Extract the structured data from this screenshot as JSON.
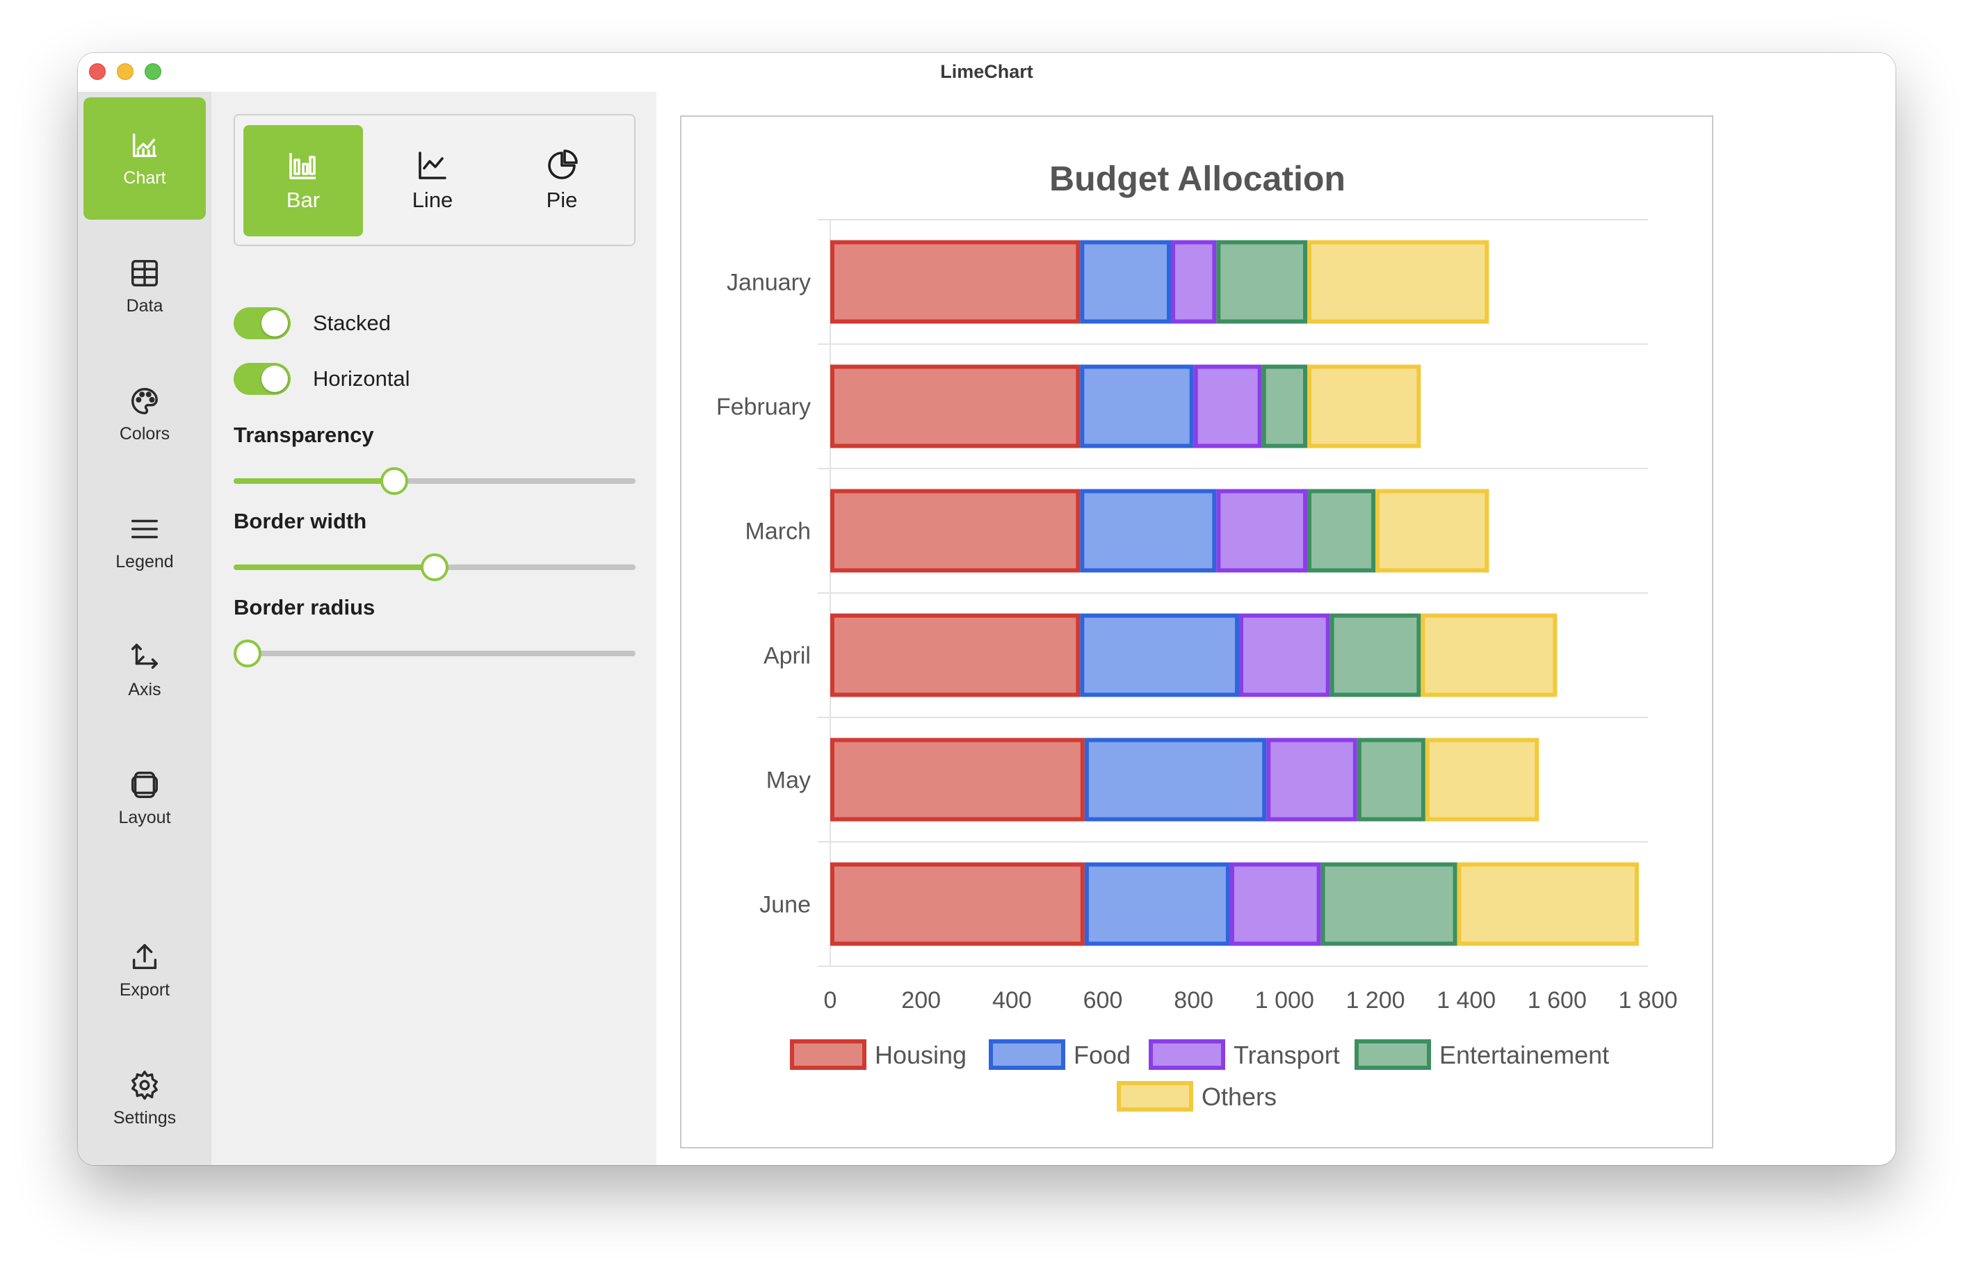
{
  "window": {
    "title": "LimeChart"
  },
  "sidebar": {
    "items": [
      {
        "label": "Chart",
        "icon": "chart-icon",
        "active": true
      },
      {
        "label": "Data",
        "icon": "table-icon",
        "active": false
      },
      {
        "label": "Colors",
        "icon": "palette-icon",
        "active": false
      },
      {
        "label": "Legend",
        "icon": "list-icon",
        "active": false
      },
      {
        "label": "Axis",
        "icon": "axis-icon",
        "active": false
      },
      {
        "label": "Layout",
        "icon": "layers-icon",
        "active": false
      },
      {
        "label": "Export",
        "icon": "upload-icon",
        "active": false
      },
      {
        "label": "Settings",
        "icon": "gear-icon",
        "active": false
      }
    ]
  },
  "panel": {
    "chart_types": [
      {
        "label": "Bar",
        "icon": "bar-chart-icon",
        "active": true
      },
      {
        "label": "Line",
        "icon": "line-chart-icon",
        "active": false
      },
      {
        "label": "Pie",
        "icon": "pie-chart-icon",
        "active": false
      }
    ],
    "toggles": [
      {
        "label": "Stacked",
        "on": true
      },
      {
        "label": "Horizontal",
        "on": true
      }
    ],
    "sliders": [
      {
        "label": "Transparency",
        "value": 0.4
      },
      {
        "label": "Border width",
        "value": 0.5
      },
      {
        "label": "Border radius",
        "value": 0.0
      }
    ]
  },
  "colors": {
    "accent": "#8dc63f"
  },
  "chart_data": {
    "type": "bar",
    "orientation": "horizontal",
    "stacked": true,
    "title": "Budget Allocation",
    "categories": [
      "January",
      "February",
      "March",
      "April",
      "May",
      "June"
    ],
    "series": [
      {
        "name": "Housing",
        "color": "#cf3a32",
        "fill": "#e0877f",
        "values": [
          550,
          550,
          550,
          550,
          560,
          560
        ]
      },
      {
        "name": "Food",
        "color": "#2f64dc",
        "fill": "#85a6ec",
        "values": [
          200,
          250,
          300,
          350,
          400,
          320
        ]
      },
      {
        "name": "Transport",
        "color": "#8a3ee8",
        "fill": "#b88cf0",
        "values": [
          100,
          150,
          200,
          200,
          200,
          200
        ]
      },
      {
        "name": "Entertainement",
        "color": "#3d8f60",
        "fill": "#8fbfa0",
        "values": [
          200,
          100,
          150,
          200,
          150,
          300
        ]
      },
      {
        "name": "Others",
        "color": "#f2c93c",
        "fill": "#f6e08e",
        "values": [
          400,
          250,
          250,
          300,
          250,
          400
        ]
      }
    ],
    "xlim": [
      0,
      1800
    ],
    "xticks": [
      "0",
      "200",
      "400",
      "600",
      "800",
      "1 000",
      "1 200",
      "1 400",
      "1 600",
      "1 800"
    ],
    "grid": true,
    "legend": "bottom"
  }
}
